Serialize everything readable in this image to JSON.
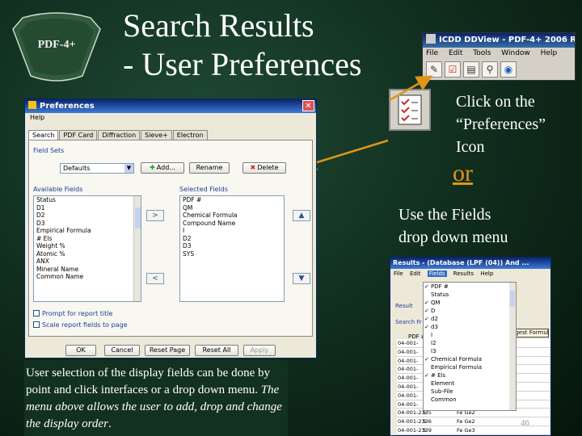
{
  "logo": {
    "text": "PDF-4+"
  },
  "title": {
    "line1": "Search Results",
    "line2": "- User Preferences"
  },
  "icdd_window": {
    "title": "ICDD DDView - PDF-4+ 2006 RDB",
    "menu": [
      "File",
      "Edit",
      "Tools",
      "Window",
      "Help"
    ]
  },
  "click_note": {
    "line1": "Click on the",
    "line2": "“Preferences”",
    "line3": "Icon"
  },
  "or_text": "or",
  "fields_note": {
    "line1": "Use the Fields",
    "line2": "drop down menu"
  },
  "preferences_dialog": {
    "title": "Preferences",
    "menu": "Help",
    "tabs": [
      "Search",
      "PDF Card",
      "Diffraction",
      "Sieve+",
      "Electron"
    ],
    "field_sets_label": "Field Sets",
    "field_set_selected": "Defaults",
    "add_label": "Add...",
    "rename_label": "Rename",
    "delete_label": "Delete",
    "available_fields_label": "Available Fields",
    "selected_fields_label": "Selected Fields",
    "available_fields": [
      "Status",
      "D1",
      "D2",
      "D3",
      "Empirical Formula",
      "# Els",
      "Weight %",
      "Atomic %",
      "ANX",
      "Mineral Name",
      "Common Name"
    ],
    "selected_fields": [
      "PDF #",
      "QM",
      "Chemical Formula",
      "Compound Name",
      "I",
      "D2",
      "D3",
      "SYS"
    ],
    "prompt_label": "Prompt for report title",
    "scale_label": "Scale report fields to page",
    "buttons": {
      "ok": "OK",
      "cancel": "Cancel",
      "reset_page": "Reset Page",
      "reset_all": "Reset All",
      "apply": "Apply"
    }
  },
  "bottom_text": {
    "normal": "User selection of the display fields can be done by point and click interfaces or a drop down menu.",
    "italic": "The menu above allows the user to add, drop and change the display order",
    "end": "."
  },
  "results_window": {
    "title": "Results - (Database (LPF (04)) And ...",
    "menu": [
      "File",
      "Edit",
      "Fields",
      "Results",
      "Help"
    ],
    "side_labels": [
      "Result",
      "Search Fr",
      "PDF #"
    ],
    "suggest": "Suggest Formula",
    "dropdown_items": [
      {
        "label": "PDF #",
        "checked": true
      },
      {
        "label": "Status",
        "checked": false
      },
      {
        "label": "QM",
        "checked": true
      },
      {
        "label": "D",
        "checked": true
      },
      {
        "label": "d2",
        "checked": true
      },
      {
        "label": "d3",
        "checked": true
      },
      {
        "label": "I",
        "checked": false
      },
      {
        "label": "I2",
        "checked": false
      },
      {
        "label": "I3",
        "checked": false
      },
      {
        "label": "Chemical Formula",
        "checked": true
      },
      {
        "label": "Empirical Formula",
        "checked": false
      },
      {
        "label": "# Els",
        "checked": true
      },
      {
        "label": "Element",
        "checked": false
      },
      {
        "label": "Sub-File",
        "checked": false
      },
      {
        "label": "Common",
        "checked": false
      }
    ],
    "rows": [
      [
        "04-001-",
        "",
        ""
      ],
      [
        "04-001-",
        "",
        ""
      ],
      [
        "04-001-",
        "",
        ""
      ],
      [
        "04-001-",
        "",
        ""
      ],
      [
        "04-001-",
        "",
        ""
      ],
      [
        "04-001-",
        "",
        ""
      ],
      [
        "04-001-",
        "",
        ""
      ],
      [
        "04-001-",
        "",
        ""
      ],
      [
        "04-001-2335",
        "S",
        "Fe Ge2"
      ],
      [
        "04-001-2336",
        "S",
        "Fe Ge2"
      ],
      [
        "04-001-2339",
        "S",
        "Fe Ge3"
      ]
    ]
  },
  "page_number": "46"
}
